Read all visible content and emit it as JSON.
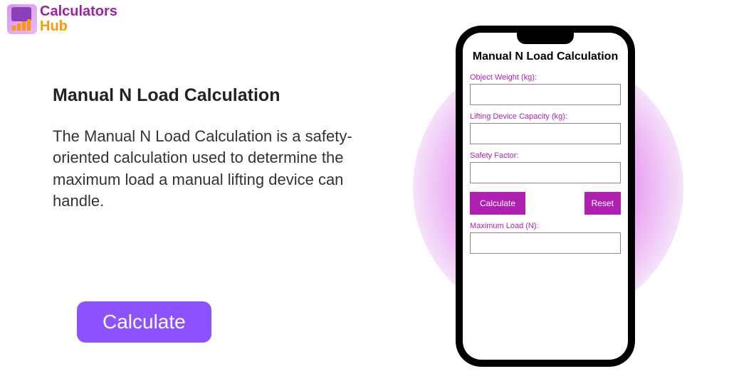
{
  "logo": {
    "top": "Calculators",
    "bottom": "Hub"
  },
  "content": {
    "title": "Manual N Load Calculation",
    "description": "The Manual N Load Calculation is a safety-oriented calculation used to determine the maximum load a manual lifting device can handle."
  },
  "cta": {
    "label": "Calculate"
  },
  "phone": {
    "title": "Manual N Load Calculation",
    "fields": {
      "weight_label": "Object Weight (kg):",
      "weight_value": "",
      "capacity_label": "Lifting Device Capacity (kg):",
      "capacity_value": "",
      "safety_label": "Safety Factor:",
      "safety_value": "",
      "result_label": "Maximum Load (N):",
      "result_value": ""
    },
    "buttons": {
      "calculate": "Calculate",
      "reset": "Reset"
    }
  }
}
